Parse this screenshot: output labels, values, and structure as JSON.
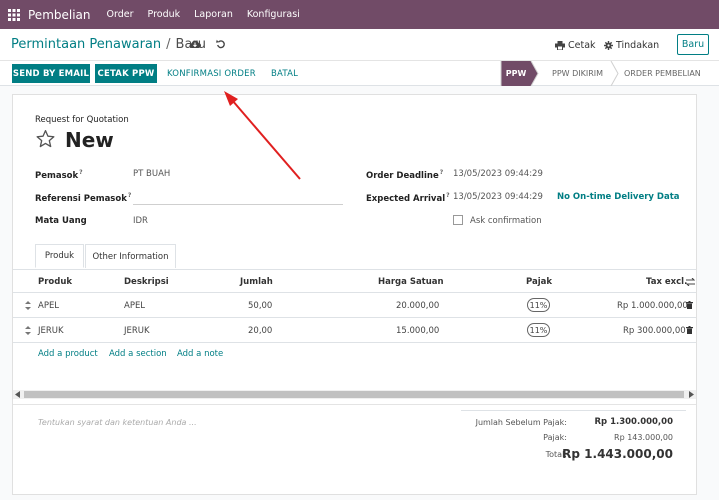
{
  "nav": {
    "app_title": "Pembelian",
    "items": [
      "Order",
      "Produk",
      "Laporan",
      "Konfigurasi"
    ]
  },
  "control": {
    "breadcrumb_parent": "Permintaan Penawaran",
    "breadcrumb_current": "Baru",
    "print_label": "Cetak",
    "action_label": "Tindakan",
    "new_label": "Baru"
  },
  "actions": {
    "send_email": "SEND BY EMAIL",
    "print_rfq": "CETAK PPW",
    "confirm": "KONFIRMASI ORDER",
    "cancel": "BATAL"
  },
  "status": {
    "steps": [
      "PPW",
      "PPW DIKIRIM",
      "ORDER PEMBELIAN"
    ],
    "active": "PPW"
  },
  "form": {
    "doc_type": "Request for Quotation",
    "name": "New",
    "vendor_label": "Pemasok",
    "vendor_value": "PT BUAH",
    "vendor_ref_label": "Referensi Pemasok",
    "vendor_ref_value": "",
    "currency_label": "Mata Uang",
    "currency_value": "IDR",
    "deadline_label": "Order Deadline",
    "deadline_value": "13/05/2023 09:44:29",
    "arrival_label": "Expected Arrival",
    "arrival_value": "13/05/2023 09:44:29",
    "on_time_label": "No On-time Delivery Data",
    "ask_confirm_label": "Ask confirmation",
    "tooltip_mark": "?"
  },
  "tabs": [
    "Produk",
    "Other Information"
  ],
  "table": {
    "headers": [
      "Produk",
      "Deskripsi",
      "Jumlah",
      "Harga Satuan",
      "Pajak",
      "Tax excl."
    ],
    "rows": [
      {
        "product": "APEL",
        "description": "APEL",
        "qty": "50,00",
        "price": "20.000,00",
        "tax": "11%",
        "subtotal": "Rp 1.000.000,00"
      },
      {
        "product": "JERUK",
        "description": "JERUK",
        "qty": "20,00",
        "price": "15.000,00",
        "tax": "11%",
        "subtotal": "Rp 300.000,00"
      }
    ],
    "add_product": "Add a product",
    "add_section": "Add a section",
    "add_note": "Add a note"
  },
  "notes_placeholder": "Tentukan syarat dan ketentuan Anda ...",
  "totals": {
    "untaxed_label": "Jumlah Sebelum Pajak:",
    "untaxed_value": "Rp 1.300.000,00",
    "tax_label": "Pajak:",
    "tax_value": "Rp 143.000,00",
    "total_label": "Total:",
    "total_value": "Rp 1.443.000,00"
  },
  "colors": {
    "brand": "#714b67",
    "accent": "#017e84",
    "annotation_arrow": "#e02020"
  }
}
